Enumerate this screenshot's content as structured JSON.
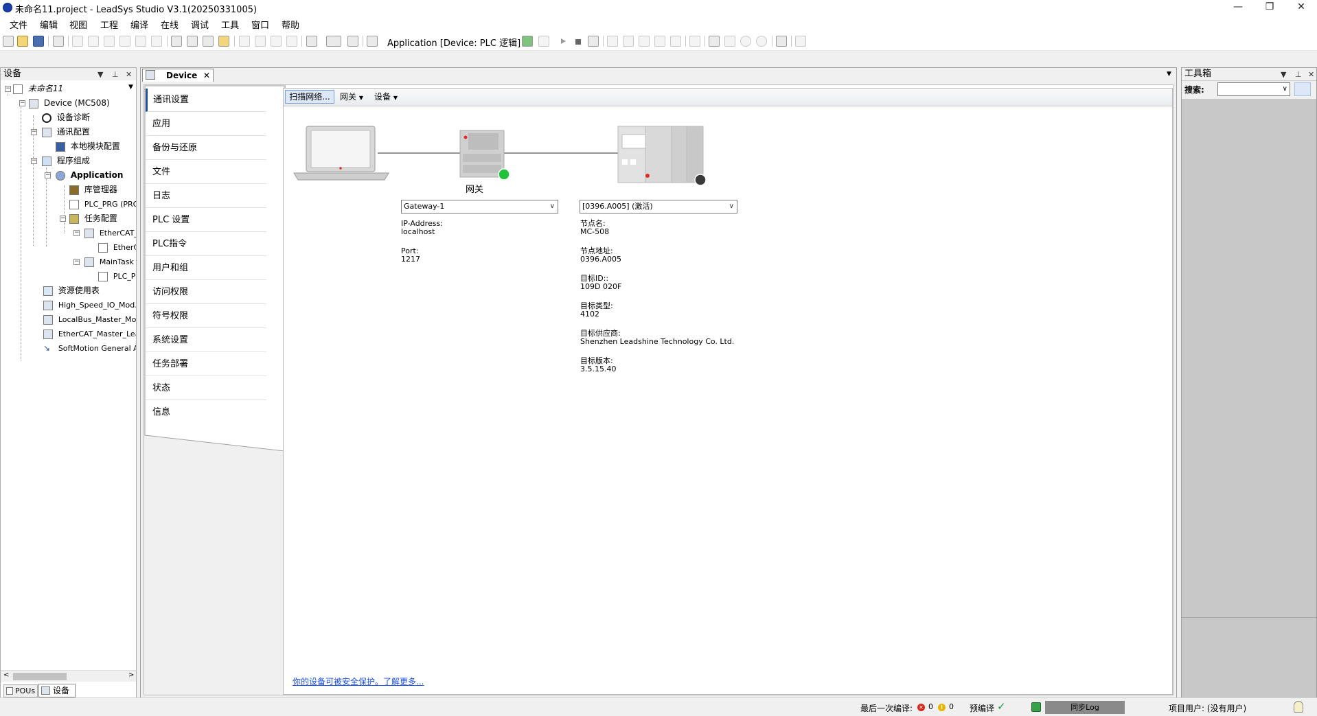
{
  "window": {
    "title": "未命名11.project - LeadSys Studio V3.1(20250331005)",
    "minimize_glyph": "—",
    "restore_glyph": "❐",
    "close_glyph": "✕"
  },
  "menu": [
    "文件",
    "编辑",
    "视图",
    "工程",
    "编译",
    "在线",
    "调试",
    "工具",
    "窗口",
    "帮助"
  ],
  "toolbar": {
    "active_application": "Application [Device: PLC 逻辑]"
  },
  "devices_panel": {
    "title": "设备",
    "project_name": "未命名11",
    "tree": [
      {
        "label": "Device (MC508)",
        "icon": "device-icon"
      },
      {
        "label": "设备诊断",
        "icon": "search-icon"
      },
      {
        "label": "通讯配置",
        "icon": "network-icon"
      },
      {
        "label": "本地模块配置",
        "icon": "module-icon"
      },
      {
        "label": "程序组成",
        "icon": "program-icon"
      },
      {
        "label": "Application",
        "icon": "application-gear-icon"
      },
      {
        "label": "库管理器",
        "icon": "library-icon"
      },
      {
        "label": "PLC_PRG (PRG)",
        "icon": "pou-icon"
      },
      {
        "label": "任务配置",
        "icon": "task-config-icon"
      },
      {
        "label": "EtherCAT_M",
        "icon": "task-icon"
      },
      {
        "label": "EtherCA",
        "icon": "pou-call-icon"
      },
      {
        "label": "MainTask",
        "icon": "task-icon"
      },
      {
        "label": "PLC_PR",
        "icon": "pou-call-icon"
      },
      {
        "label": "资源使用表",
        "icon": "table-icon"
      },
      {
        "label": "High_Speed_IO_Mod...",
        "icon": "io-module-icon"
      },
      {
        "label": "LocalBus_Master_Module",
        "icon": "bus-module-icon"
      },
      {
        "label": "EtherCAT_Master_Leads",
        "icon": "ethercat-module-icon"
      },
      {
        "label": "SoftMotion General Axis",
        "icon": "axis-icon"
      }
    ],
    "bottom_tabs": [
      "POUs",
      "设备"
    ]
  },
  "editor": {
    "tab_title": "Device",
    "nav_items": [
      "通讯设置",
      "应用",
      "备份与还原",
      "文件",
      "日志",
      "PLC 设置",
      "PLC指令",
      "用户和组",
      "访问权限",
      "符号权限",
      "系统设置",
      "任务部署",
      "状态",
      "信息"
    ],
    "sub_toolbar": {
      "scan": "扫描网络...",
      "gateway_menu": "网关",
      "device_menu": "设备"
    },
    "gateway_label": "网关",
    "gateway_combo": "Gateway-1",
    "device_combo": "[0396.A005] (激活)",
    "gateway_info": [
      {
        "key": "IP-Address:",
        "value": "localhost"
      },
      {
        "key": "Port:",
        "value": "1217"
      }
    ],
    "device_info": [
      {
        "key": "节点名:",
        "value": "MC-508"
      },
      {
        "key": "节点地址:",
        "value": "0396.A005"
      },
      {
        "key": "目标ID::",
        "value": "109D 020F"
      },
      {
        "key": "目标类型:",
        "value": "4102"
      },
      {
        "key": "目标供应商:",
        "value": "Shenzhen Leadshine Technology Co. Ltd."
      },
      {
        "key": "目标版本:",
        "value": "3.5.15.40"
      }
    ],
    "security_link": "你的设备可被安全保护。了解更多..."
  },
  "toolbox_panel": {
    "title": "工具箱",
    "search_label": "搜索:",
    "search_value": ""
  },
  "statusbar": {
    "last_compile_label": "最后一次编译:",
    "errors": "0",
    "warnings": "0",
    "precompile_label": "预编译",
    "sync_log": "同步Log",
    "project_user": "项目用户: (没有用户)"
  },
  "colors": {
    "accent": "#1f4e9e",
    "link": "#1a4ff0",
    "status_online": "#22c33a",
    "status_offline": "#3a3a3a",
    "error_red": "#d9261c",
    "warning_yellow": "#e8b400"
  }
}
